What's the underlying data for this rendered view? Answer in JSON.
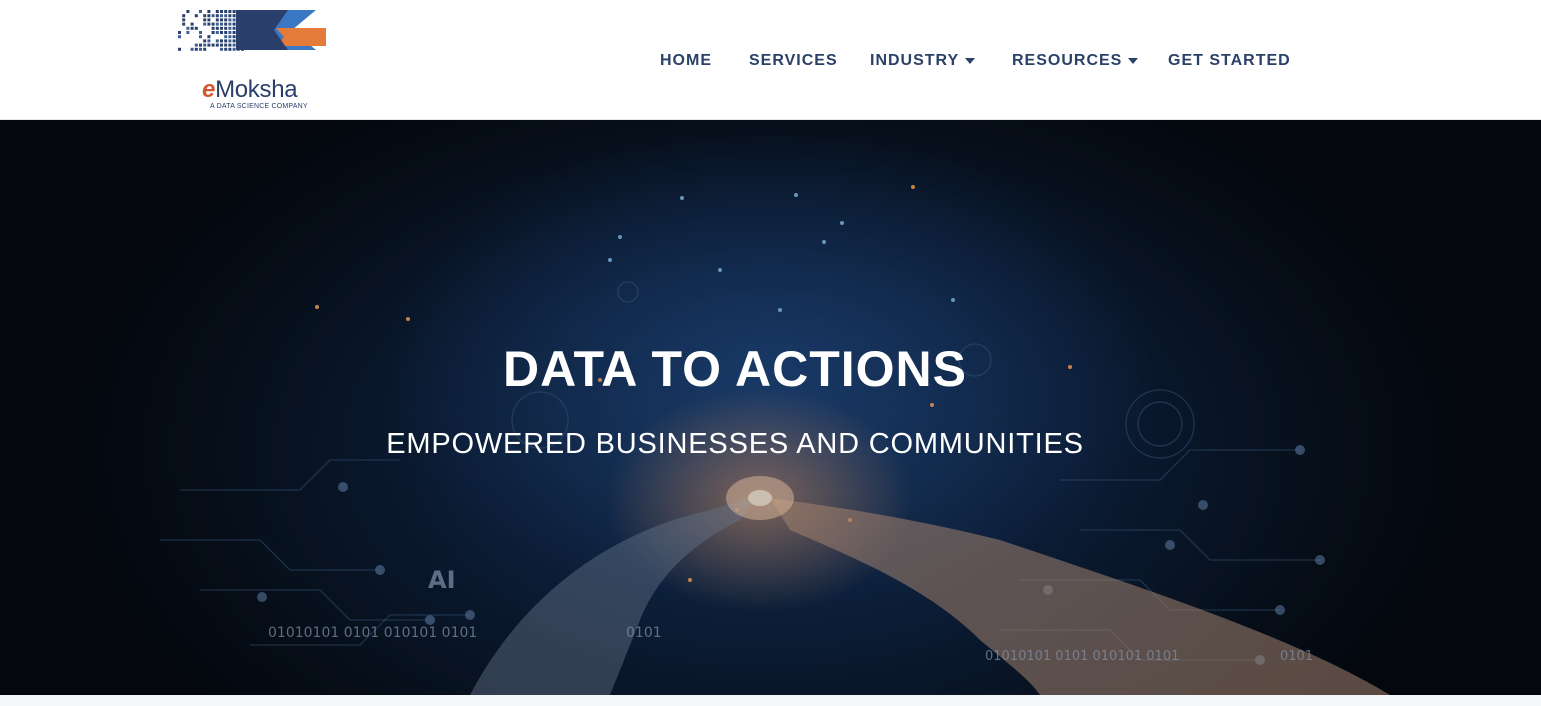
{
  "brand": {
    "name_prefix": "e",
    "name_rest": "Moksha",
    "tagline": "A DATA SCIENCE COMPANY",
    "colors": {
      "navy": "#2a3f6b",
      "orange": "#e57b3a",
      "blue": "#3a78c4"
    }
  },
  "nav": {
    "items": [
      {
        "label": "HOME",
        "dropdown": false
      },
      {
        "label": "SERVICES",
        "dropdown": false
      },
      {
        "label": "INDUSTRY",
        "dropdown": true
      },
      {
        "label": "RESOURCES",
        "dropdown": true
      },
      {
        "label": "GET STARTED",
        "dropdown": false
      }
    ]
  },
  "hero": {
    "title": "DATA TO ACTIONS",
    "subtitle": "EMPOWERED BUSINESSES AND COMMUNITIES",
    "image_text": {
      "ai": "AI",
      "binary_1": "01010101 0101 010101 0101",
      "binary_2": "0101",
      "binary_3": "01010101 0101 010101 0101",
      "binary_4": "0101"
    }
  }
}
